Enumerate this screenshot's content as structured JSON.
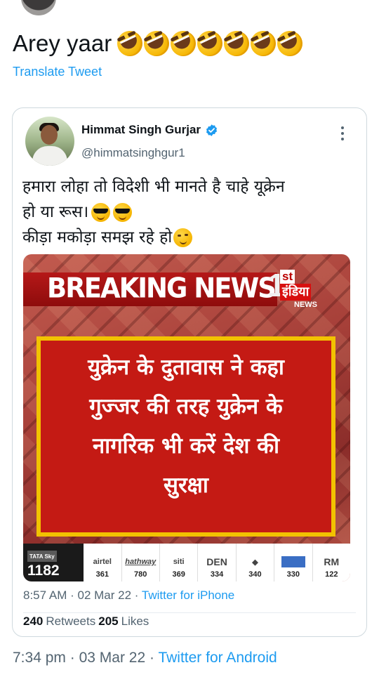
{
  "tweet": {
    "text": "Arey yaar",
    "emoji_count": 7,
    "emoji_icon": "rolling-on-the-floor-laughing",
    "translate_label": "Translate Tweet",
    "time": "7:34 pm",
    "separator": "·",
    "date": "03 Mar 22",
    "source": "Twitter for Android"
  },
  "quoted": {
    "name": "Himmat Singh Gurjar",
    "verified": true,
    "handle": "@himmatsinghgur1",
    "text_line1": "हमारा लोहा तो विदेशी भी मानते है चाहे यूक्रेन",
    "text_line2": "हो या रूस।",
    "text_line3": "कीड़ा मकोड़ा समझ रहे हो",
    "time": "8:57 AM",
    "date": "02 Mar 22",
    "separator": "·",
    "source": "Twitter for iPhone",
    "retweets_count": "240",
    "retweets_label": "Retweets",
    "likes_count": "205",
    "likes_label": "Likes",
    "media": {
      "banner": "BREAKING NEWS",
      "logo_number": "1",
      "logo_st": "st",
      "logo_name": "इंडिया",
      "logo_news": "NEWS",
      "headline_lines": [
        "युक्रेन के दुतावास ने कहा",
        "गुज्जर की तरह युक्रेन के",
        "नागरिक भी करें देश की",
        "सुरक्षा"
      ],
      "channels": [
        {
          "name": "TATA Sky",
          "number": "1182"
        },
        {
          "name": "airtel",
          "number": "361"
        },
        {
          "name": "hathway",
          "number": "780"
        },
        {
          "name": "siti",
          "number": "369"
        },
        {
          "name": "DEN",
          "number": "334"
        },
        {
          "name": "",
          "number": "340"
        },
        {
          "name": "",
          "number": "330"
        },
        {
          "name": "RM",
          "number": "122"
        }
      ]
    }
  },
  "colors": {
    "link": "#1d9bf0",
    "muted": "#536471",
    "text": "#0f1419",
    "breaking_red": "#b51818",
    "frame_yellow": "#f2c200"
  }
}
